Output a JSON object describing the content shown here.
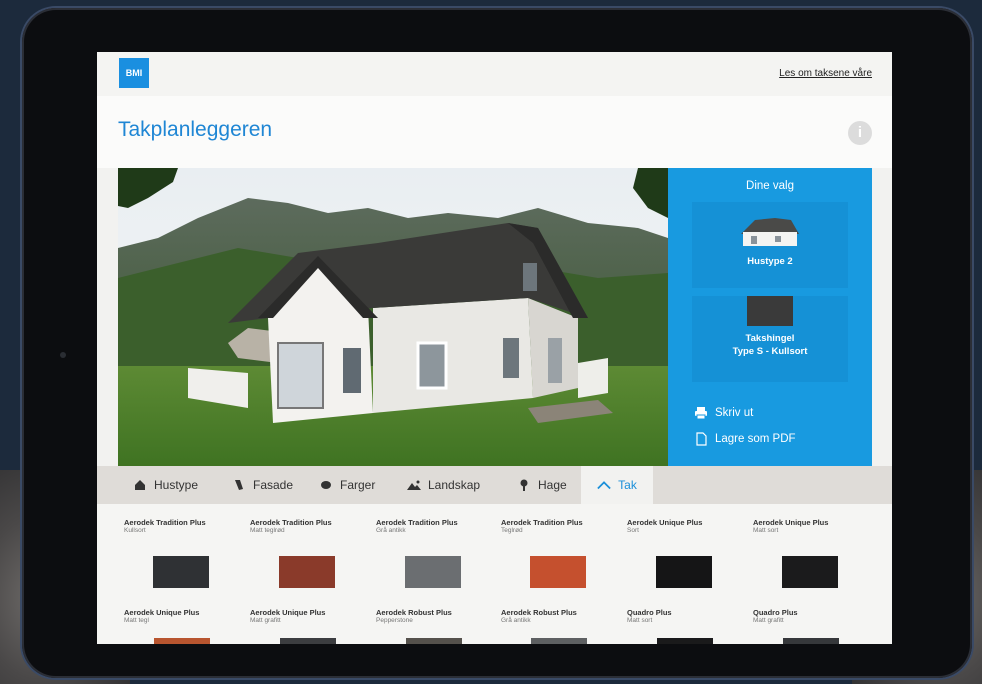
{
  "header": {
    "logo_text": "BMI",
    "top_link": "Les om taksene våre",
    "title": "Takplanleggeren"
  },
  "panel": {
    "title": "Dine valg",
    "house_label": "Hustype 2",
    "tile_label_1": "Takshingel",
    "tile_label_2": "Type S - Kullsort",
    "print_label": "Skriv ut",
    "pdf_label": "Lagre som PDF"
  },
  "tabs": [
    {
      "label": "Hustype",
      "icon": "house-icon"
    },
    {
      "label": "Fasade",
      "icon": "brush-icon"
    },
    {
      "label": "Farger",
      "icon": "palette-icon"
    },
    {
      "label": "Landskap",
      "icon": "landscape-icon"
    },
    {
      "label": "Hage",
      "icon": "tree-icon"
    },
    {
      "label": "Tak",
      "icon": "roof-icon",
      "active": true
    }
  ],
  "products_row1": [
    {
      "name": "Aerodek Tradition Plus",
      "variant": "Kullsort",
      "color": "#2f3134"
    },
    {
      "name": "Aerodek Tradition Plus",
      "variant": "Matt teglrød",
      "color": "#8a3a2a"
    },
    {
      "name": "Aerodek Tradition Plus",
      "variant": "Grå antikk",
      "color": "#6b6e71"
    },
    {
      "name": "Aerodek Tradition Plus",
      "variant": "Teglrød",
      "color": "#c5502e"
    },
    {
      "name": "Aerodek Unique Plus",
      "variant": "Sort",
      "color": "#151516"
    },
    {
      "name": "Aerodek Unique Plus",
      "variant": "Matt sort",
      "color": "#1b1b1c"
    }
  ],
  "products_row2": [
    {
      "name": "Aerodek Unique Plus",
      "variant": "Matt tegl",
      "color": "#b8552f"
    },
    {
      "name": "Aerodek Unique Plus",
      "variant": "Matt grafitt",
      "color": "#3c3d40"
    },
    {
      "name": "Aerodek Robust Plus",
      "variant": "Pepperstone",
      "color": "#55514c"
    },
    {
      "name": "Aerodek Robust Plus",
      "variant": "Grå antikk",
      "color": "#5e6062"
    },
    {
      "name": "Quadro Plus",
      "variant": "Matt sort",
      "color": "#1a1a1b"
    },
    {
      "name": "Quadro Plus",
      "variant": "Matt grafitt",
      "color": "#36383b"
    }
  ],
  "colors": {
    "accent": "#189ae0",
    "title_blue": "#1f86d4"
  }
}
